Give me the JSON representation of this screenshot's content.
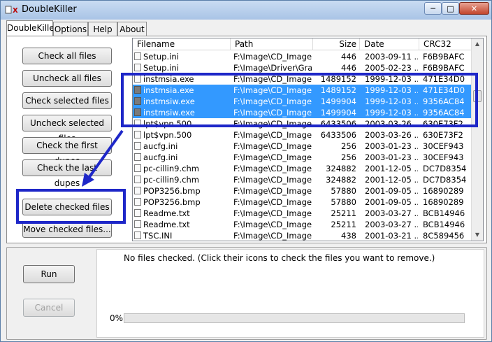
{
  "window": {
    "title": "DoubleKiller",
    "icon": "doublekiller-app-icon",
    "controls": [
      "minimize",
      "maximize",
      "close"
    ]
  },
  "tabs": [
    {
      "label": "DoubleKiller",
      "active": true
    },
    {
      "label": "Options",
      "active": false
    },
    {
      "label": "Help",
      "active": false
    },
    {
      "label": "About",
      "active": false
    }
  ],
  "left_buttons": [
    {
      "label": "Check all files"
    },
    {
      "label": "Uncheck all files"
    },
    {
      "label": "Check selected files"
    },
    {
      "label": "Uncheck selected files"
    },
    {
      "label": "Check the first dupes"
    },
    {
      "label": "Check the last dupes"
    },
    {
      "label": "Delete checked files"
    },
    {
      "label": "Move checked files..."
    }
  ],
  "file_list": {
    "columns": [
      "Filename",
      "Path",
      "Size",
      "Date",
      "CRC32"
    ],
    "rows": [
      {
        "filename": "Setup.ini",
        "path": "F:\\Image\\CD_Image...",
        "size": "446",
        "date": "2003-09-11 ...",
        "crc": "F6B9BAFC",
        "selected": false
      },
      {
        "filename": "Setup.ini",
        "path": "F:\\Image\\Driver\\Gra...",
        "size": "446",
        "date": "2005-02-23 ...",
        "crc": "F6B9BAFC",
        "selected": false
      },
      {
        "filename": "instmsia.exe",
        "path": "F:\\Image\\CD_Image...",
        "size": "1489152",
        "date": "1999-12-03 ...",
        "crc": "471E34D0",
        "selected": false
      },
      {
        "filename": "instmsia.exe",
        "path": "F:\\Image\\CD_Image...",
        "size": "1489152",
        "date": "1999-12-03 ...",
        "crc": "471E34D0",
        "selected": true
      },
      {
        "filename": "instmsiw.exe",
        "path": "F:\\Image\\CD_Image...",
        "size": "1499904",
        "date": "1999-12-03 ...",
        "crc": "9356AC84",
        "selected": true
      },
      {
        "filename": "instmsiw.exe",
        "path": "F:\\Image\\CD_Image...",
        "size": "1499904",
        "date": "1999-12-03 ...",
        "crc": "9356AC84",
        "selected": true
      },
      {
        "filename": "lpt$vpn.500",
        "path": "F:\\Image\\CD_Image...",
        "size": "6433506",
        "date": "2003-03-26 ...",
        "crc": "630E73F2",
        "selected": false
      },
      {
        "filename": "lpt$vpn.500",
        "path": "F:\\Image\\CD_Image...",
        "size": "6433506",
        "date": "2003-03-26 ...",
        "crc": "630E73F2",
        "selected": false
      },
      {
        "filename": "aucfg.ini",
        "path": "F:\\Image\\CD_Image...",
        "size": "256",
        "date": "2003-01-23 ...",
        "crc": "30CEF943",
        "selected": false
      },
      {
        "filename": "aucfg.ini",
        "path": "F:\\Image\\CD_Image...",
        "size": "256",
        "date": "2003-01-23 ...",
        "crc": "30CEF943",
        "selected": false
      },
      {
        "filename": "pc-cillin9.chm",
        "path": "F:\\Image\\CD_Image...",
        "size": "324882",
        "date": "2001-12-05 ...",
        "crc": "DC7D8354",
        "selected": false
      },
      {
        "filename": "pc-cillin9.chm",
        "path": "F:\\Image\\CD_Image...",
        "size": "324882",
        "date": "2001-12-05 ...",
        "crc": "DC7D8354",
        "selected": false
      },
      {
        "filename": "POP3256.bmp",
        "path": "F:\\Image\\CD_Image...",
        "size": "57880",
        "date": "2001-09-05 ...",
        "crc": "16890289",
        "selected": false
      },
      {
        "filename": "POP3256.bmp",
        "path": "F:\\Image\\CD_Image...",
        "size": "57880",
        "date": "2001-09-05 ...",
        "crc": "16890289",
        "selected": false
      },
      {
        "filename": "Readme.txt",
        "path": "F:\\Image\\CD_Image...",
        "size": "25211",
        "date": "2003-03-27 ...",
        "crc": "BCB14946",
        "selected": false
      },
      {
        "filename": "Readme.txt",
        "path": "F:\\Image\\CD_Image...",
        "size": "25211",
        "date": "2003-03-27 ...",
        "crc": "BCB14946",
        "selected": false
      },
      {
        "filename": "TSC.INI",
        "path": "F:\\Image\\CD_Image...",
        "size": "438",
        "date": "2001-03-21 ...",
        "crc": "8C589456",
        "selected": false
      }
    ]
  },
  "bottom": {
    "run_label": "Run",
    "cancel_label": "Cancel",
    "status": "No files checked. (Click their icons to check the files you want to remove.)",
    "progress_label": "0%",
    "progress_value": 0
  },
  "colors": {
    "selection": "#3399ff",
    "highlight_box": "#1e27c8"
  }
}
